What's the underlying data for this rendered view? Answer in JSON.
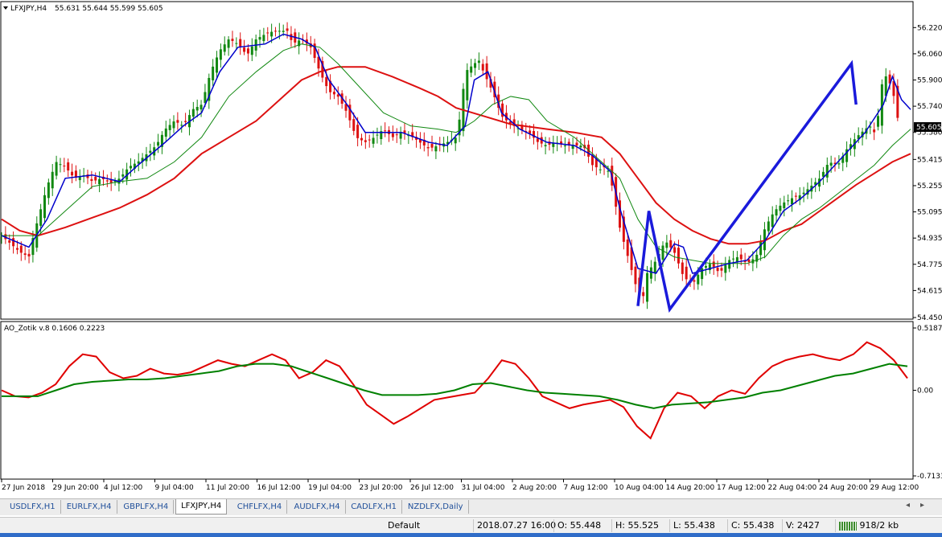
{
  "chart_data": [
    {
      "type": "candlestick",
      "title": "LFXJPY,H4",
      "ohlc_header": "55.631 55.644 55.599 55.605",
      "ylim": [
        54.45,
        56.3
      ],
      "y_ticks": [
        "56.220",
        "56.060",
        "55.900",
        "55.740",
        "55.580",
        "55.415",
        "55.255",
        "55.095",
        "54.935",
        "54.775",
        "54.615",
        "54.450"
      ],
      "current_price": "55.605",
      "x_labels": [
        "27 Jun 2018",
        "29 Jun 20:00",
        "4 Jul 12:00",
        "9 Jul 04:00",
        "11 Jul 20:00",
        "16 Jul 12:00",
        "19 Jul 04:00",
        "23 Jul 20:00",
        "26 Jul 12:00",
        "31 Jul 04:00",
        "2 Aug 20:00",
        "7 Aug 12:00",
        "10 Aug 04:00",
        "14 Aug 20:00",
        "17 Aug 12:00",
        "22 Aug 04:00",
        "24 Aug 20:00",
        "29 Aug 12:00"
      ],
      "close_path": [
        [
          0,
          54.95
        ],
        [
          0.01,
          54.9
        ],
        [
          0.02,
          54.85
        ],
        [
          0.03,
          54.82
        ],
        [
          0.035,
          54.95
        ],
        [
          0.04,
          55.05
        ],
        [
          0.05,
          55.25
        ],
        [
          0.06,
          55.4
        ],
        [
          0.07,
          55.37
        ],
        [
          0.08,
          55.3
        ],
        [
          0.09,
          55.32
        ],
        [
          0.1,
          55.28
        ],
        [
          0.11,
          55.3
        ],
        [
          0.12,
          55.27
        ],
        [
          0.13,
          55.3
        ],
        [
          0.14,
          55.37
        ],
        [
          0.15,
          55.4
        ],
        [
          0.16,
          55.45
        ],
        [
          0.17,
          55.5
        ],
        [
          0.18,
          55.6
        ],
        [
          0.19,
          55.65
        ],
        [
          0.2,
          55.62
        ],
        [
          0.21,
          55.72
        ],
        [
          0.22,
          55.75
        ],
        [
          0.23,
          55.95
        ],
        [
          0.24,
          56.08
        ],
        [
          0.25,
          56.15
        ],
        [
          0.26,
          56.12
        ],
        [
          0.27,
          56.05
        ],
        [
          0.28,
          56.15
        ],
        [
          0.29,
          56.18
        ],
        [
          0.3,
          56.2
        ],
        [
          0.31,
          56.2
        ],
        [
          0.315,
          56.2
        ],
        [
          0.32,
          56.12
        ],
        [
          0.33,
          56.15
        ],
        [
          0.34,
          56.1
        ],
        [
          0.35,
          55.95
        ],
        [
          0.36,
          55.83
        ],
        [
          0.37,
          55.8
        ],
        [
          0.38,
          55.7
        ],
        [
          0.39,
          55.55
        ],
        [
          0.4,
          55.52
        ],
        [
          0.41,
          55.55
        ],
        [
          0.42,
          55.6
        ],
        [
          0.43,
          55.55
        ],
        [
          0.44,
          55.58
        ],
        [
          0.45,
          55.56
        ],
        [
          0.46,
          55.52
        ],
        [
          0.47,
          55.48
        ],
        [
          0.48,
          55.5
        ],
        [
          0.49,
          55.52
        ],
        [
          0.5,
          55.55
        ],
        [
          0.505,
          55.7
        ],
        [
          0.51,
          55.95
        ],
        [
          0.52,
          56.0
        ],
        [
          0.525,
          56.02
        ],
        [
          0.53,
          55.95
        ],
        [
          0.54,
          55.83
        ],
        [
          0.55,
          55.68
        ],
        [
          0.56,
          55.63
        ],
        [
          0.57,
          55.6
        ],
        [
          0.58,
          55.58
        ],
        [
          0.59,
          55.52
        ],
        [
          0.6,
          55.5
        ],
        [
          0.61,
          55.52
        ],
        [
          0.62,
          55.5
        ],
        [
          0.63,
          55.5
        ],
        [
          0.64,
          55.5
        ],
        [
          0.645,
          55.44
        ],
        [
          0.65,
          55.38
        ],
        [
          0.66,
          55.35
        ],
        [
          0.665,
          55.38
        ],
        [
          0.67,
          55.3
        ],
        [
          0.68,
          55.0
        ],
        [
          0.69,
          54.8
        ],
        [
          0.7,
          54.6
        ],
        [
          0.705,
          54.55
        ],
        [
          0.71,
          54.72
        ],
        [
          0.72,
          54.8
        ],
        [
          0.73,
          54.92
        ],
        [
          0.74,
          54.85
        ],
        [
          0.75,
          54.7
        ],
        [
          0.76,
          54.65
        ],
        [
          0.77,
          54.75
        ],
        [
          0.78,
          54.78
        ],
        [
          0.79,
          54.72
        ],
        [
          0.8,
          54.8
        ],
        [
          0.81,
          54.82
        ],
        [
          0.82,
          54.78
        ],
        [
          0.83,
          54.82
        ],
        [
          0.84,
          55.0
        ],
        [
          0.85,
          55.1
        ],
        [
          0.86,
          55.15
        ],
        [
          0.87,
          55.18
        ],
        [
          0.88,
          55.2
        ],
        [
          0.89,
          55.25
        ],
        [
          0.9,
          55.3
        ],
        [
          0.91,
          55.4
        ],
        [
          0.92,
          55.38
        ],
        [
          0.93,
          55.48
        ],
        [
          0.94,
          55.55
        ],
        [
          0.95,
          55.6
        ],
        [
          0.955,
          55.62
        ],
        [
          0.96,
          55.58
        ],
        [
          0.965,
          55.7
        ],
        [
          0.97,
          55.95
        ],
        [
          0.975,
          55.9
        ],
        [
          0.98,
          55.85
        ],
        [
          0.985,
          55.68
        ],
        [
          0.99,
          55.6
        ]
      ],
      "ema_fast": [
        [
          0,
          54.95
        ],
        [
          0.03,
          54.88
        ],
        [
          0.05,
          55.05
        ],
        [
          0.07,
          55.3
        ],
        [
          0.1,
          55.32
        ],
        [
          0.13,
          55.28
        ],
        [
          0.15,
          55.38
        ],
        [
          0.18,
          55.52
        ],
        [
          0.2,
          55.62
        ],
        [
          0.22,
          55.7
        ],
        [
          0.24,
          55.95
        ],
        [
          0.26,
          56.1
        ],
        [
          0.29,
          56.12
        ],
        [
          0.31,
          56.18
        ],
        [
          0.33,
          56.15
        ],
        [
          0.345,
          56.1
        ],
        [
          0.36,
          55.9
        ],
        [
          0.38,
          55.75
        ],
        [
          0.4,
          55.58
        ],
        [
          0.42,
          55.58
        ],
        [
          0.44,
          55.58
        ],
        [
          0.47,
          55.52
        ],
        [
          0.49,
          55.5
        ],
        [
          0.51,
          55.62
        ],
        [
          0.52,
          55.9
        ],
        [
          0.535,
          55.95
        ],
        [
          0.55,
          55.7
        ],
        [
          0.57,
          55.6
        ],
        [
          0.6,
          55.52
        ],
        [
          0.63,
          55.5
        ],
        [
          0.65,
          55.44
        ],
        [
          0.67,
          55.34
        ],
        [
          0.68,
          55.12
        ],
        [
          0.7,
          54.75
        ],
        [
          0.72,
          54.72
        ],
        [
          0.74,
          54.9
        ],
        [
          0.75,
          54.88
        ],
        [
          0.76,
          54.72
        ],
        [
          0.78,
          54.75
        ],
        [
          0.8,
          54.78
        ],
        [
          0.82,
          54.8
        ],
        [
          0.84,
          54.92
        ],
        [
          0.86,
          55.1
        ],
        [
          0.88,
          55.18
        ],
        [
          0.9,
          55.28
        ],
        [
          0.92,
          55.4
        ],
        [
          0.95,
          55.58
        ],
        [
          0.97,
          55.75
        ],
        [
          0.98,
          55.92
        ],
        [
          0.99,
          55.78
        ],
        [
          1.0,
          55.72
        ]
      ],
      "ma_green": [
        [
          0,
          54.95
        ],
        [
          0.04,
          54.95
        ],
        [
          0.07,
          55.1
        ],
        [
          0.1,
          55.25
        ],
        [
          0.13,
          55.28
        ],
        [
          0.16,
          55.3
        ],
        [
          0.19,
          55.4
        ],
        [
          0.22,
          55.55
        ],
        [
          0.25,
          55.8
        ],
        [
          0.28,
          55.95
        ],
        [
          0.31,
          56.08
        ],
        [
          0.33,
          56.12
        ],
        [
          0.35,
          56.1
        ],
        [
          0.37,
          56.0
        ],
        [
          0.39,
          55.88
        ],
        [
          0.42,
          55.7
        ],
        [
          0.45,
          55.62
        ],
        [
          0.48,
          55.6
        ],
        [
          0.5,
          55.58
        ],
        [
          0.52,
          55.65
        ],
        [
          0.54,
          55.75
        ],
        [
          0.56,
          55.8
        ],
        [
          0.58,
          55.78
        ],
        [
          0.6,
          55.65
        ],
        [
          0.63,
          55.55
        ],
        [
          0.66,
          55.4
        ],
        [
          0.68,
          55.3
        ],
        [
          0.7,
          55.05
        ],
        [
          0.72,
          54.88
        ],
        [
          0.74,
          54.82
        ],
        [
          0.76,
          54.8
        ],
        [
          0.78,
          54.78
        ],
        [
          0.8,
          54.78
        ],
        [
          0.82,
          54.78
        ],
        [
          0.84,
          54.82
        ],
        [
          0.86,
          54.95
        ],
        [
          0.88,
          55.05
        ],
        [
          0.9,
          55.12
        ],
        [
          0.93,
          55.25
        ],
        [
          0.96,
          55.38
        ],
        [
          0.98,
          55.5
        ],
        [
          1.0,
          55.6
        ]
      ],
      "ma_red": [
        [
          0,
          55.05
        ],
        [
          0.02,
          54.98
        ],
        [
          0.04,
          54.95
        ],
        [
          0.07,
          55.0
        ],
        [
          0.1,
          55.06
        ],
        [
          0.13,
          55.12
        ],
        [
          0.16,
          55.2
        ],
        [
          0.19,
          55.3
        ],
        [
          0.22,
          55.45
        ],
        [
          0.25,
          55.55
        ],
        [
          0.28,
          55.65
        ],
        [
          0.31,
          55.8
        ],
        [
          0.33,
          55.9
        ],
        [
          0.35,
          55.95
        ],
        [
          0.37,
          55.98
        ],
        [
          0.4,
          55.98
        ],
        [
          0.43,
          55.92
        ],
        [
          0.46,
          55.85
        ],
        [
          0.48,
          55.8
        ],
        [
          0.5,
          55.73
        ],
        [
          0.53,
          55.68
        ],
        [
          0.56,
          55.63
        ],
        [
          0.6,
          55.6
        ],
        [
          0.63,
          55.58
        ],
        [
          0.66,
          55.55
        ],
        [
          0.68,
          55.45
        ],
        [
          0.7,
          55.3
        ],
        [
          0.72,
          55.15
        ],
        [
          0.74,
          55.05
        ],
        [
          0.76,
          54.98
        ],
        [
          0.78,
          54.93
        ],
        [
          0.8,
          54.9
        ],
        [
          0.82,
          54.9
        ],
        [
          0.84,
          54.92
        ],
        [
          0.86,
          54.98
        ],
        [
          0.88,
          55.02
        ],
        [
          0.9,
          55.1
        ],
        [
          0.92,
          55.18
        ],
        [
          0.94,
          55.26
        ],
        [
          0.96,
          55.33
        ],
        [
          0.98,
          55.4
        ],
        [
          1.0,
          55.45
        ]
      ],
      "zigzag": [
        [
          0.7,
          54.52
        ],
        [
          0.712,
          55.1
        ],
        [
          0.735,
          54.5
        ],
        [
          0.935,
          56.0
        ],
        [
          0.94,
          55.75
        ]
      ],
      "indicator": {
        "title": "AO_Zotik v.8 0.1606 0.2223",
        "y_ticks": [
          "0.5187",
          "0.00",
          "-0.7133"
        ],
        "ylim": [
          -0.7133,
          0.5187
        ],
        "series": [
          {
            "color": "#e00000",
            "values": [
              0.0,
              -0.05,
              -0.06,
              -0.02,
              0.05,
              0.2,
              0.3,
              0.28,
              0.15,
              0.1,
              0.12,
              0.18,
              0.14,
              0.13,
              0.15,
              0.2,
              0.25,
              0.22,
              0.2,
              0.25,
              0.3,
              0.25,
              0.1,
              0.15,
              0.25,
              0.2,
              0.05,
              -0.12,
              -0.2,
              -0.28,
              -0.22,
              -0.15,
              -0.08,
              -0.06,
              -0.04,
              -0.02,
              0.1,
              0.25,
              0.22,
              0.1,
              -0.05,
              -0.1,
              -0.15,
              -0.12,
              -0.1,
              -0.08,
              -0.14,
              -0.3,
              -0.4,
              -0.15,
              -0.02,
              -0.05,
              -0.15,
              -0.05,
              0.0,
              -0.03,
              0.1,
              0.2,
              0.25,
              0.28,
              0.3,
              0.27,
              0.25,
              0.3,
              0.4,
              0.35,
              0.25,
              0.1
            ]
          },
          {
            "color": "#008000",
            "values": [
              -0.05,
              -0.05,
              -0.05,
              0.0,
              0.05,
              0.07,
              0.08,
              0.09,
              0.09,
              0.1,
              0.12,
              0.14,
              0.16,
              0.2,
              0.22,
              0.22,
              0.2,
              0.15,
              0.1,
              0.05,
              0.0,
              -0.04,
              -0.04,
              -0.04,
              -0.03,
              0.0,
              0.05,
              0.06,
              0.03,
              0.0,
              -0.02,
              -0.03,
              -0.04,
              -0.05,
              -0.08,
              -0.12,
              -0.15,
              -0.12,
              -0.11,
              -0.1,
              -0.08,
              -0.06,
              -0.02,
              0.0,
              0.04,
              0.08,
              0.12,
              0.14,
              0.18,
              0.22,
              0.2
            ]
          }
        ]
      }
    }
  ],
  "tabs": [
    "USDLFX,H1",
    "EURLFX,H4",
    "GBPLFX,H4",
    "LFXJPY,H4",
    "CHFLFX,H4",
    "AUDLFX,H4",
    "CADLFX,H1",
    "NZDLFX,Daily"
  ],
  "active_tab": "LFXJPY,H4",
  "status": {
    "profile": "Default",
    "time": "2018.07.27 16:00",
    "open": "O: 55.448",
    "high": "H: 55.525",
    "low": "L: 55.438",
    "close": "C: 55.438",
    "volume": "V: 2427",
    "traffic": "918/2 kb"
  },
  "colors": {
    "ma_red": "#dd1111",
    "ma_green": "#118811",
    "ema_fast": "#0000cc",
    "zigzag": "#1a1adb",
    "bull": "#118811",
    "bear": "#dd1111",
    "ind_red": "#e00000",
    "ind_green": "#008000"
  }
}
